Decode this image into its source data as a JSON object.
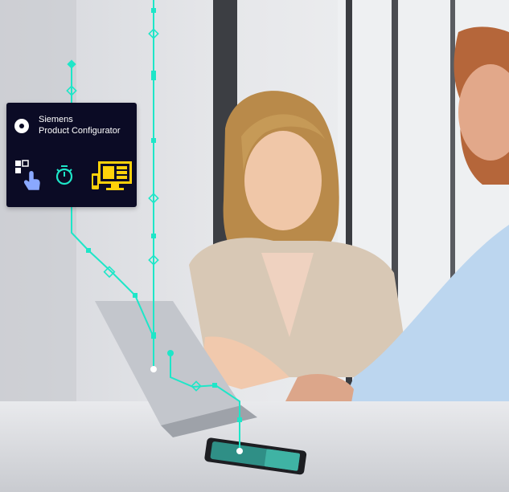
{
  "card": {
    "brand": "Siemens",
    "product": "Product Configurator",
    "icons": [
      "configure-touch-icon",
      "stopwatch-icon",
      "multi-device-icon"
    ]
  },
  "colors": {
    "card_bg": "#0b0b25",
    "accent_teal": "#1ee6c8",
    "icon_blue": "#8aa8ff",
    "icon_yellow": "#ffd20a"
  }
}
